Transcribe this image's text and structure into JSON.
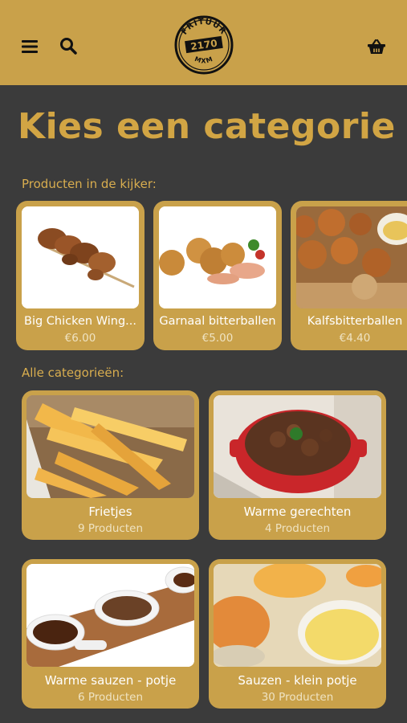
{
  "header": {
    "logo": {
      "top_text": "FRITUUR",
      "number": "2170",
      "bottom_text": "MXM"
    },
    "icons": {
      "menu": "hamburger-icon",
      "search": "search-icon",
      "basket": "basket-icon"
    },
    "accent_color": "#c9a14a"
  },
  "page_title": "Kies een categorie",
  "featured": {
    "label": "Producten in de kijker:",
    "items": [
      {
        "name": "Big Chicken Wing...",
        "price": "€6.00"
      },
      {
        "name": "Garnaal bitterballen",
        "price": "€5.00"
      },
      {
        "name": "Kalfsbitterballen",
        "price": "€4.40"
      }
    ]
  },
  "categories": {
    "label": "Alle categorieën:",
    "items": [
      {
        "name": "Frietjes",
        "count": "9 Producten"
      },
      {
        "name": "Warme gerechten",
        "count": "4 Producten"
      },
      {
        "name": "Warme sauzen - potje",
        "count": "6 Producten"
      },
      {
        "name": "Sauzen - klein potje",
        "count": "30 Producten"
      }
    ]
  },
  "colors": {
    "background": "#3b3b3b",
    "card": "#c9a14a",
    "title": "#d2a544"
  }
}
